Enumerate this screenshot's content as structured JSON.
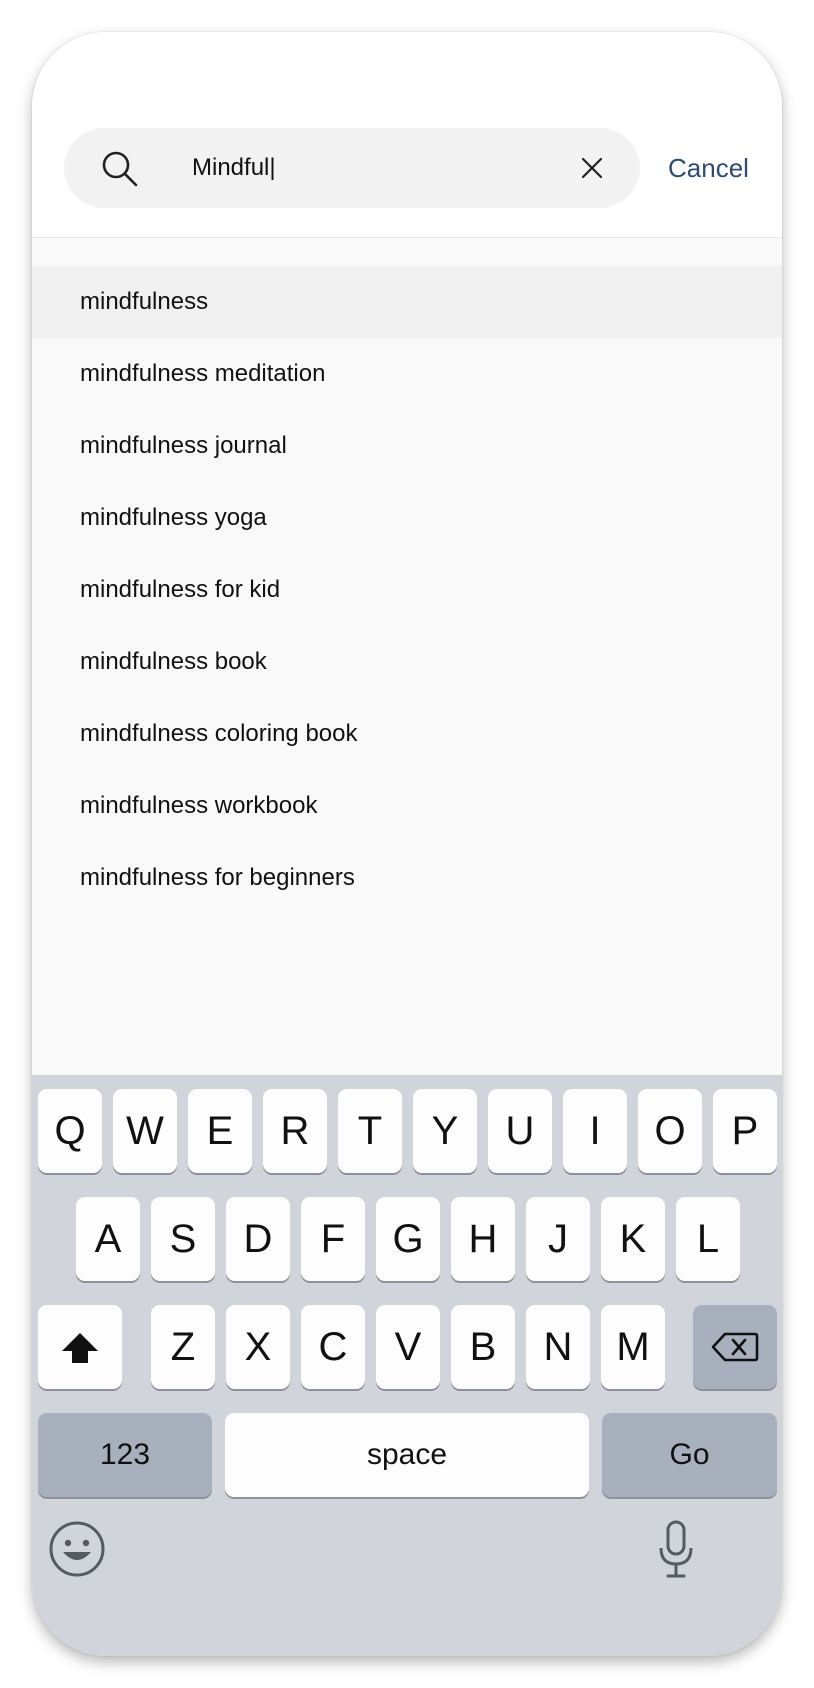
{
  "search": {
    "query": "Mindful|",
    "cancel_label": "Cancel"
  },
  "suggestions": [
    "mindfulness",
    "mindfulness meditation",
    "mindfulness journal",
    "mindfulness yoga",
    "mindfulness for kid",
    "mindfulness book",
    "mindfulness coloring book",
    "mindfulness workbook",
    "mindfulness for beginners"
  ],
  "keyboard": {
    "row1": [
      "Q",
      "W",
      "E",
      "R",
      "T",
      "Y",
      "U",
      "I",
      "O",
      "P"
    ],
    "row2": [
      "A",
      "S",
      "D",
      "F",
      "G",
      "H",
      "J",
      "K",
      "L"
    ],
    "row3": [
      "Z",
      "X",
      "C",
      "V",
      "B",
      "N",
      "M"
    ],
    "numbers_label": "123",
    "space_label": "space",
    "go_label": "Go"
  },
  "icons": {
    "search": "search-icon",
    "clear": "close-icon",
    "shift": "shift-icon",
    "backspace": "backspace-icon",
    "emoji": "emoji-icon",
    "mic": "microphone-icon"
  },
  "colors": {
    "accent": "#2e4b70",
    "keyboard_bg": "#d1d4db",
    "key_dark": "#a9b0bd"
  }
}
